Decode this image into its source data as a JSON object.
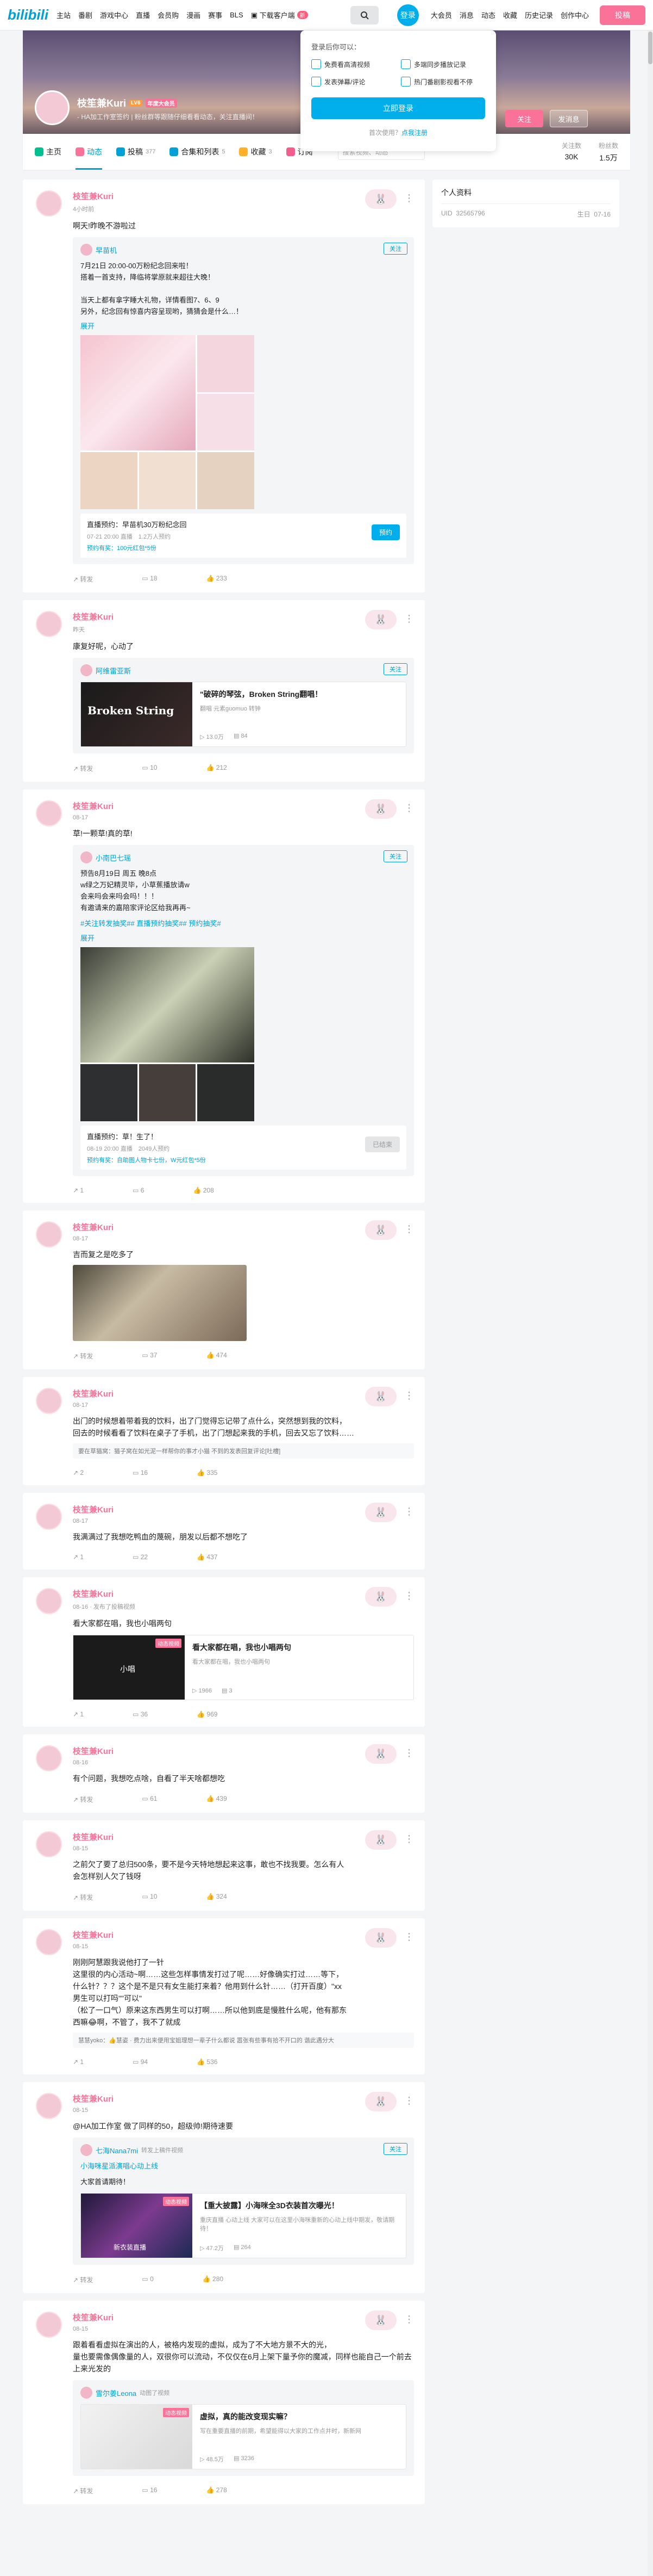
{
  "topbar": {
    "logo": "bilibili",
    "nav_left": [
      "主站",
      "番剧",
      "游戏中心",
      "直播",
      "会员购",
      "漫画",
      "赛事",
      "BLS"
    ],
    "download": "下载客户端",
    "download_badge": "新",
    "login": "登录",
    "nav_right": [
      "大会员",
      "消息",
      "动态",
      "收藏",
      "历史记录",
      "创作中心"
    ],
    "post": "投稿"
  },
  "login_popup": {
    "title": "登录后你可以：",
    "benefits": [
      "免费看高清视频",
      "多端同步播放记录",
      "发表弹幕/评论",
      "热门番剧影视看不停"
    ],
    "button": "立即登录",
    "register_prefix": "首次使用？",
    "register_link": "点我注册"
  },
  "profile": {
    "name": "枝笙兼Kuri",
    "level": "LV6",
    "vip": "年度大会员",
    "sign": "- HA加工作室签约 | 粉丝群等跟随仔细看看动态，关注直播间！",
    "follow": "关注",
    "message": "发消息"
  },
  "tabs": [
    {
      "label": "主页",
      "count": "",
      "color": "#00c091"
    },
    {
      "label": "动态",
      "count": "",
      "color": "#fb7299"
    },
    {
      "label": "投稿",
      "count": "377",
      "color": "#00a1d6"
    },
    {
      "label": "合集和列表",
      "count": "5",
      "color": "#00a1d6"
    },
    {
      "label": "收藏",
      "count": "3",
      "color": "#ffb027"
    },
    {
      "label": "订阅",
      "count": "",
      "color": "#f25d8e"
    }
  ],
  "space_search_placeholder": "搜索视频、动态",
  "stats": [
    {
      "label": "关注数",
      "value": "30K"
    },
    {
      "label": "粉丝数",
      "value": "1.5万"
    }
  ],
  "side": {
    "title": "个人资料",
    "uid_label": "UID",
    "uid": "32565796",
    "birthday_label": "生日",
    "birthday": "07-16"
  },
  "posts": [
    {
      "name": "枝笙兼Kuri",
      "time": "4小时前",
      "text": "啊天!昨晚不游啦过",
      "repost": {
        "author": "早苗机",
        "follow": "关注",
        "text": "7月21日 20:00-00万粉纪念回来啦！\n搭着一首支持，降临将掌原就来超往大晚！\n\n当天上都有拿字睡大礼物，详情看图7、6、9\n另外，纪念回有惊喜内容呈现哟，猜猜会是什么…！",
        "expand": "展开",
        "live_title": "直播预约：早苗机30万粉纪念回",
        "live_sub": "07-21 20:00 直播　1.2万人预约",
        "live_gift": "预约有奖：100元红包*5份",
        "live_btn": "预约"
      },
      "actions": [
        "转发",
        "18",
        "233"
      ]
    },
    {
      "name": "枝笙兼Kuri",
      "time": "昨天",
      "text": "康复好呢，心动了",
      "repost": {
        "author": "阿维雷亚斯",
        "follow": "关注",
        "video_title": "\"破碎的琴弦，Broken String翻唱！",
        "video_desc": "翻唱 元素guomuo 转钟",
        "thumb": "Broken String",
        "views": "13.0万",
        "danmaku": "84"
      },
      "actions": [
        "转发",
        "10",
        "212"
      ]
    },
    {
      "name": "枝笙兼Kuri",
      "time": "08-17",
      "text": "草!一颗草!真的草!",
      "repost": {
        "author": "小南巴七瑶",
        "follow": "关注",
        "text": "预告8月19日 周五 晚8点\nw绿之万妃精灵毕，小草蕉播放请w\n会来吗会来吗会吗！！！\n有邀请来的嘉陪家评论区给我再再~",
        "tags": "#关注转发抽奖## 直播预约抽奖## 预约抽奖#",
        "expand": "展开",
        "live_title": "直播预约：草！生了！",
        "live_sub": "08-19 20:00 直播　2049人预约",
        "live_gift": "预约有奖：自助图人物卡七份，W元红包*5份",
        "live_btn": "已结束"
      },
      "actions": [
        "1",
        "6",
        "208"
      ]
    },
    {
      "name": "枝笙兼Kuri",
      "time": "08-17",
      "text": "吉而复之是吃多了",
      "actions": [
        "转发",
        "37",
        "474"
      ]
    },
    {
      "name": "枝笙兼Kuri",
      "time": "08-17",
      "text": "出门的时候想着带着我的饮料，出了门觉得忘记带了点什么，突然想到我的饮料，\n回去的时候看看了饮料在桌子了手机，出了门想起来我的手机，回去又忘了饮料……",
      "comment": "要在草猫窝：猫子窝在如光泥一样帮你的事才小猫 不到的发表回复评论[吐槽]",
      "actions": [
        "2",
        "16",
        "335"
      ]
    },
    {
      "name": "枝笙兼Kuri",
      "time": "08-17",
      "text": "我满满过了我想吃鸭血的蔑碗，朋发以后都不想吃了",
      "actions": [
        "1",
        "22",
        "437"
      ]
    },
    {
      "name": "枝笙兼Kuri",
      "time": "08-16",
      "post_note": "· 发布了投稿视频",
      "text": "看大家都在唱，我也小唱两句",
      "video": {
        "video_title": "看大家都在唱，我也小唱两句",
        "video_desc": "看大家都在唱，我也小唱两句",
        "thumb": "小唱",
        "chip": "动态视频",
        "views": "1966",
        "danmaku": "3"
      },
      "actions": [
        "1",
        "36",
        "969"
      ]
    },
    {
      "name": "枝笙兼Kuri",
      "time": "08-16",
      "text": "有个问题，我想吃点啥，自看了半天啥都想吃",
      "actions": [
        "转发",
        "61",
        "439"
      ]
    },
    {
      "name": "枝笙兼Kuri",
      "time": "08-15",
      "text": "之前欠了要了总归500条，要不是今天特地想起来这事，敢也不找我要。怎么有人\n会怎样别人欠了钱呀",
      "actions": [
        "转发",
        "10",
        "324"
      ]
    },
    {
      "name": "枝笙兼Kuri",
      "time": "08-15",
      "text": "刚刚阿慧跟我说他打了一针\n这里很的内心活动~啊……这些怎样事情发打过了呢……好像确实打过……等下，\n什么针？？？这个是不是只有女生能打来着？他用到什么针……（打开百度）\"xx\n男生可以打吗\"\"可以\"\n（松了一口气）原来这东西男生可以打啊……所以他到底是慢胜什么呢，他有那东\n西嘛😂啊，不管了，我不了就成",
      "comment": "慧慧yoko：👍慧姿 · 费力出来便用宝姐理想一辈子什么都说 嚣张有些事有拾不开口的 谐此遇分大",
      "actions": [
        "1",
        "94",
        "536"
      ]
    },
    {
      "name": "枝笙兼Kuri",
      "time": "08-15",
      "text": "@HA加工作室 做了同样的50，超级帅!期待速要",
      "repost": {
        "author": "七海Nana7mi",
        "follow": "关注",
        "sub": "转发上稿件视频",
        "desc": "小海咪星派演唱心动上线",
        "text": "大家首请期待！",
        "video_title": "【重大披露】小海咪全3D衣装首次曝光！",
        "video_desc": "重庆直播 心动上线 大家可以在这里小海咪重新的心动上线中期发，敬请期待！",
        "thumb": "新衣装直播",
        "chip": "动态视频",
        "views": "47.2万",
        "danmaku": "264"
      },
      "actions": [
        "转发",
        "0",
        "280"
      ]
    },
    {
      "name": "枝笙兼Kuri",
      "time": "08-15",
      "text": "跟着看看虚拟在演出的人，被格内发现的虚拟，成为了不大地方景不大的光，\n量也要需像偶像量的人，双很你可以流动，不仅仅在6月上架下量予你的魔减，同样也能自己一个前去上来光发的",
      "repost": {
        "author": "雪尔姜Leona",
        "follow": "",
        "sub": "动图了视频",
        "video_title": "虚拟，真的能改变现实嘛？",
        "video_desc": "写在重要直播的前期，希望能得以大家的工作点并时，新新网",
        "thumb": "",
        "chip": "动态视频",
        "views": "48.5万",
        "danmaku": "3236"
      },
      "actions": [
        "转发",
        "16",
        "278"
      ]
    }
  ]
}
